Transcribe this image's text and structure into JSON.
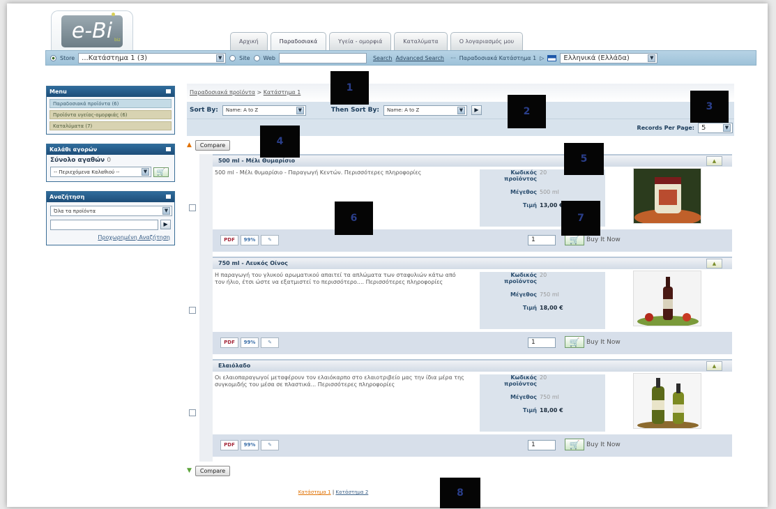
{
  "header": {
    "logo_text": "e-Bi",
    "logo_tag": "biz",
    "tabs": [
      {
        "label": "Αρχική"
      },
      {
        "label": "Παραδοσιακά"
      },
      {
        "label": "Υγεία - ομορφιά"
      },
      {
        "label": "Καταλύματα"
      },
      {
        "label": "Ο λογαριασμός μου"
      }
    ]
  },
  "searchbar": {
    "store_label": "Store",
    "store_value": "...Κατάστημα 1 (3)",
    "site_label": "Site",
    "web_label": "Web",
    "search_link": "Search",
    "advanced_link": "Advanced Search",
    "breadcrumb_right": "Παραδοσιακά Κατάστημα 1",
    "language": "Ελληνικά (Ελλάδα)"
  },
  "sidebar": {
    "menu": {
      "title": "Menu",
      "items": [
        {
          "label": "Παραδοσιακά προϊόντα (6)"
        },
        {
          "label": "Προϊόντα υγείας-ομορφιάς (6)"
        },
        {
          "label": "Καταλύματα (7)"
        }
      ]
    },
    "cart": {
      "title": "Καλάθι αγορών",
      "total_label": "Σύνολο αγαθών",
      "total_value": "0",
      "select_value": "-- Περιεχόμενα Καλαθιού --"
    },
    "search": {
      "title": "Αναζήτηση",
      "select_value": "Όλα τα προϊόντα",
      "advanced_link": "Προχωρημένη Αναζήτηση"
    }
  },
  "main": {
    "breadcrumb": {
      "parent": "Παραδοσιακά προϊόντα",
      "sep": " > ",
      "current": "Κατάστημα 1"
    },
    "sort": {
      "sort_by_label": "Sort By:",
      "sort_by_value": "Name: A to Z",
      "then_sort_label": "Then Sort By:",
      "then_sort_value": "Name: A to Z"
    },
    "records": {
      "label": "Records Per Page:",
      "value": "5"
    },
    "compare_label": "Compare",
    "labels": {
      "code": "Κωδικός προϊόντος",
      "size": "Μέγεθος",
      "price": "Τιμή",
      "buy": "Buy It Now",
      "pdf": "PDF",
      "percent": "99%"
    },
    "products": [
      {
        "title": "500 ml - Μέλι Θυμαρίσιο",
        "description": "500 ml - Μέλι θυμαρίσιο - Παραγωγή Κεντών. Περισσότερες πληροφορίες",
        "code": "20",
        "size": "500 ml",
        "price": "13,00 €",
        "qty": "1"
      },
      {
        "title": "750 ml - Λευκός Οίνος",
        "description": "Η παραγωγή του γλυκού αρωματικού απαιτεί τα απλώματα των σταφυλιών κάτω από τον ήλιο, έτσι ώστε να εξατμιστεί το περισσότερο.... Περισσότερες πληροφορίες",
        "code": "20",
        "size": "750 ml",
        "price": "18,00 €",
        "qty": "1"
      },
      {
        "title": "Ελαιόλαδο",
        "description": "Οι ελαιοπαραγωγοί μεταφέρουν τον ελαιόκαρπο στο ελαιοτριβείο μας την ίδια μέρα της συγκομιδής του μέσα σε πλαστικά... Περισσότερες πληροφορίες",
        "code": "20",
        "size": "750 ml",
        "price": "18,00 €",
        "qty": "1"
      }
    ],
    "pager": {
      "page1": "Κατάστημα 1",
      "sep": " | ",
      "page2": "Κατάστημα 2"
    }
  },
  "overlays": [
    "1",
    "2",
    "3",
    "4",
    "5",
    "6",
    "7",
    "8"
  ]
}
